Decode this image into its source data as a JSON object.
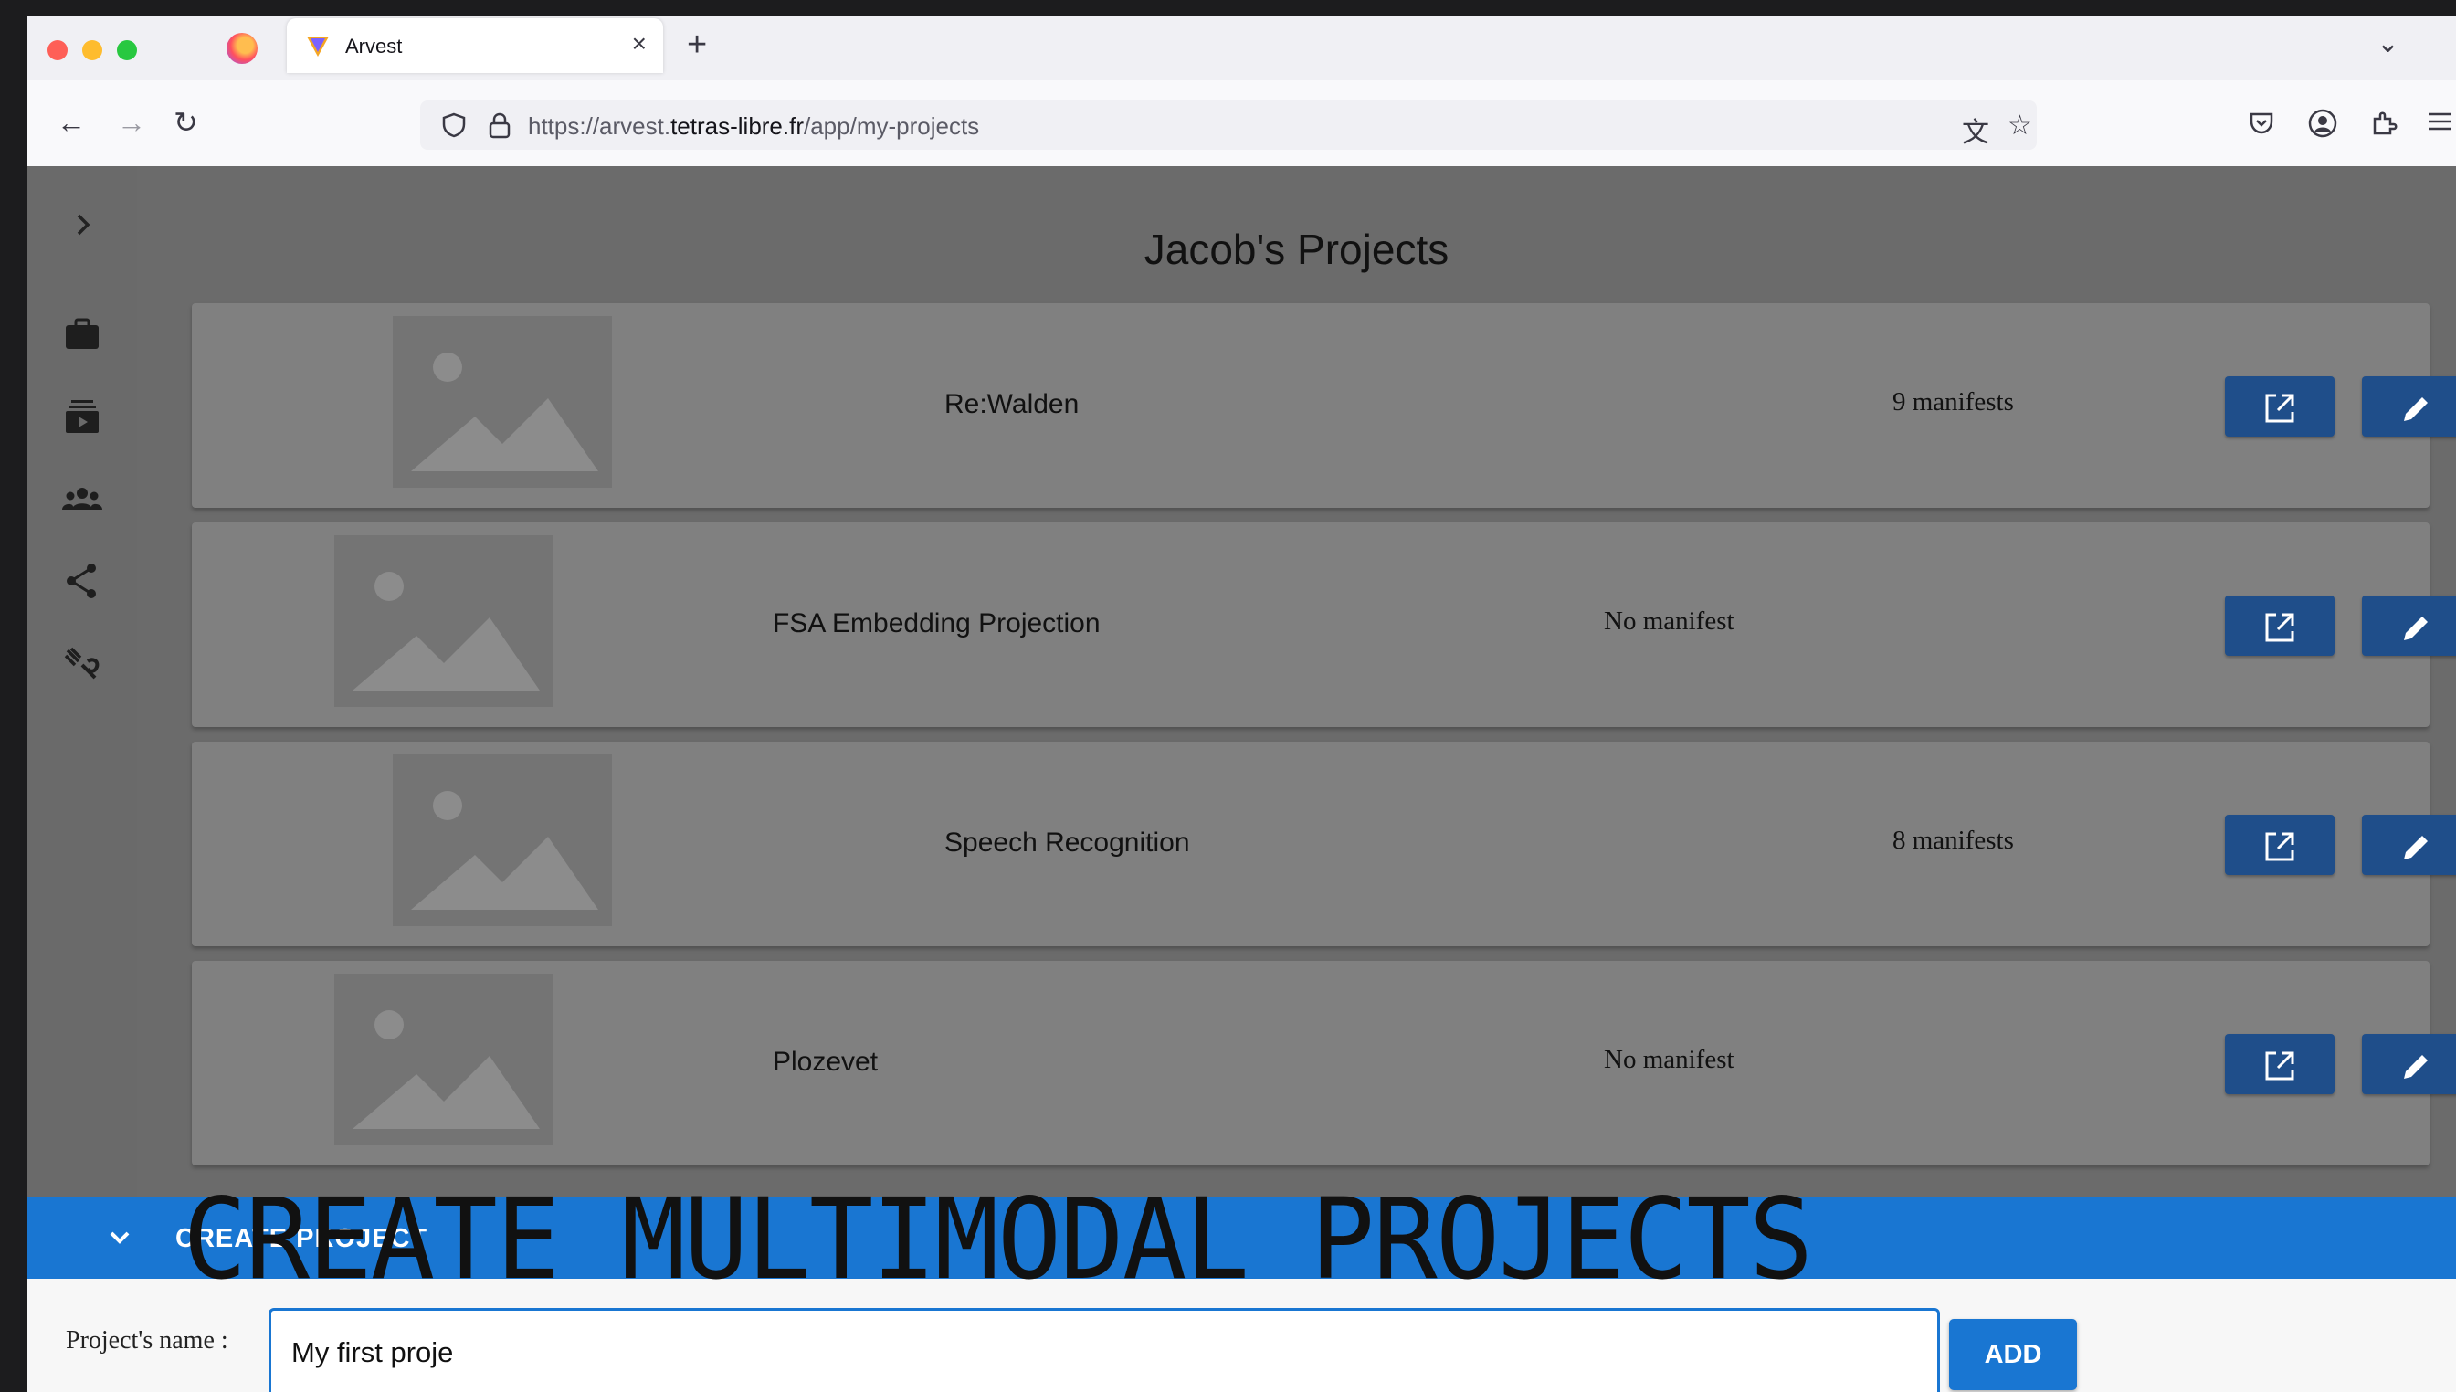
{
  "browser": {
    "tab_title": "Arvest",
    "url_prefix": "https://arvest.",
    "url_domain": "tetras-libre.fr",
    "url_path": "/app/my-projects"
  },
  "page": {
    "title": "Jacob's Projects"
  },
  "projects": [
    {
      "name": "Re:Walden",
      "manifests": "9 manifests"
    },
    {
      "name": "FSA Embedding Projection",
      "manifests": "No manifest"
    },
    {
      "name": "Speech Recognition",
      "manifests": "8 manifests"
    },
    {
      "name": "Plozevet",
      "manifests": "No manifest"
    }
  ],
  "create": {
    "header": "CREATE PROJECT",
    "name_label": "Project's name :",
    "name_value": "My first proje",
    "add_label": "ADD"
  },
  "overlay": {
    "caption": "CREATE MULTIMODAL PROJECTS"
  },
  "colors": {
    "accent": "#1976d2",
    "action_button": "#1f4e8a",
    "content_background": "#6b6b6b",
    "card_background": "#808080"
  }
}
